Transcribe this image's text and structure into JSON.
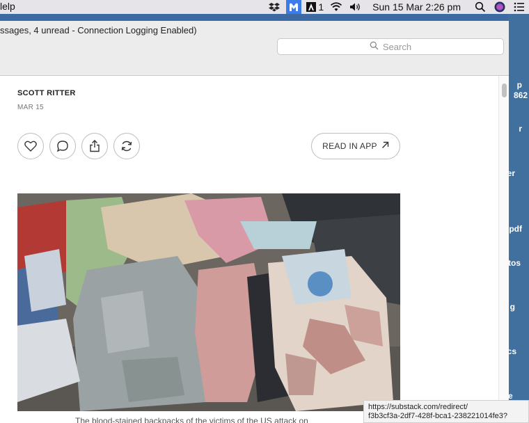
{
  "menubar": {
    "help_label": "lelp",
    "badge_count": "1",
    "datetime": "Sun 15 Mar  2:26 pm"
  },
  "desktop": {
    "labels": [
      "p",
      "862",
      "r",
      "er",
      "pdf",
      "tos",
      "g",
      "cs",
      "e or"
    ]
  },
  "window": {
    "title": "ssages, 4 unread - Connection Logging Enabled)",
    "search_placeholder": "Search"
  },
  "post": {
    "author": "SCOTT RITTER",
    "date": "MAR 15",
    "read_in_app_label": "READ IN APP",
    "caption": "The blood-stained backpacks of the victims of the US attack on"
  },
  "status_url": {
    "line1": "https://substack.com/redirect/",
    "line2": "f3b3cf3a-2df7-428f-bca1-238221014fe3?"
  },
  "colors": {
    "menubar_bg": "#e6e4e8",
    "desktop_bg": "#41709f",
    "accent_blue": "#3b7ce8"
  }
}
